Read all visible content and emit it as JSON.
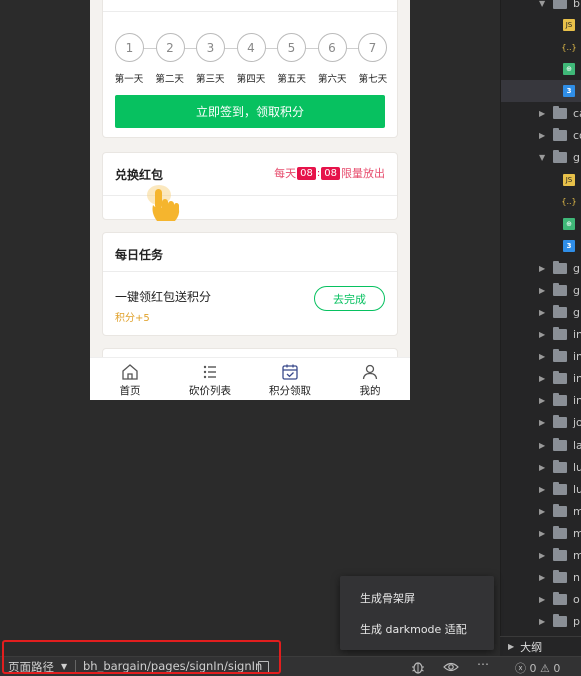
{
  "signin": {
    "days": [
      "1",
      "2",
      "3",
      "4",
      "5",
      "6",
      "7"
    ],
    "day_labels": [
      "第一天",
      "第二天",
      "第三天",
      "第四天",
      "第五天",
      "第六天",
      "第七天"
    ],
    "button": "立即签到，领取积分"
  },
  "redeem": {
    "title": "兑换红包",
    "timer_prefix": "每天",
    "hour": "08",
    "minute": "08",
    "timer_suffix": "限量放出"
  },
  "tasks": {
    "title": "每日任务",
    "item_name": "一键领红包送积分",
    "item_points": "积分+5",
    "item_button": "去完成"
  },
  "tabbar": [
    {
      "label": "首页",
      "icon": "home-icon"
    },
    {
      "label": "砍价列表",
      "icon": "list-icon"
    },
    {
      "label": "积分领取",
      "icon": "calendar-check-icon"
    },
    {
      "label": "我的",
      "icon": "user-icon"
    }
  ],
  "filetree": {
    "rows": [
      {
        "type": "folder-open",
        "name": "b"
      },
      {
        "type": "js",
        "name": ""
      },
      {
        "type": "json",
        "name": ""
      },
      {
        "type": "vue",
        "name": ""
      },
      {
        "type": "css",
        "name": ""
      },
      {
        "type": "folder",
        "name": "ca"
      },
      {
        "type": "folder",
        "name": "co"
      },
      {
        "type": "folder-open",
        "name": "g"
      },
      {
        "type": "js",
        "name": ""
      },
      {
        "type": "json",
        "name": ""
      },
      {
        "type": "vue",
        "name": ""
      },
      {
        "type": "css",
        "name": ""
      },
      {
        "type": "folder",
        "name": "g"
      },
      {
        "type": "folder",
        "name": "g"
      },
      {
        "type": "folder",
        "name": "g"
      },
      {
        "type": "folder",
        "name": "in"
      },
      {
        "type": "folder",
        "name": "in"
      },
      {
        "type": "folder",
        "name": "in"
      },
      {
        "type": "folder",
        "name": "in"
      },
      {
        "type": "folder",
        "name": "jo"
      },
      {
        "type": "folder",
        "name": "la"
      },
      {
        "type": "folder",
        "name": "lu"
      },
      {
        "type": "folder",
        "name": "lu"
      },
      {
        "type": "folder",
        "name": "m"
      },
      {
        "type": "folder",
        "name": "m"
      },
      {
        "type": "folder",
        "name": "m"
      },
      {
        "type": "folder",
        "name": "n"
      },
      {
        "type": "folder",
        "name": "o"
      },
      {
        "type": "folder",
        "name": "p"
      }
    ],
    "outline_label": "大纲"
  },
  "popup": {
    "item1": "生成骨架屏",
    "item2": "生成 darkmode 适配"
  },
  "statusbar": {
    "path_label": "页面路径",
    "path": "bh_bargain/pages/signIn/signIn",
    "errors": "0",
    "warnings": "0"
  },
  "colors": {
    "accent_green": "#07c160",
    "highlight_red": "#e21e1e",
    "timer_red": "#e6134a",
    "points_orange": "#e0a12b"
  }
}
